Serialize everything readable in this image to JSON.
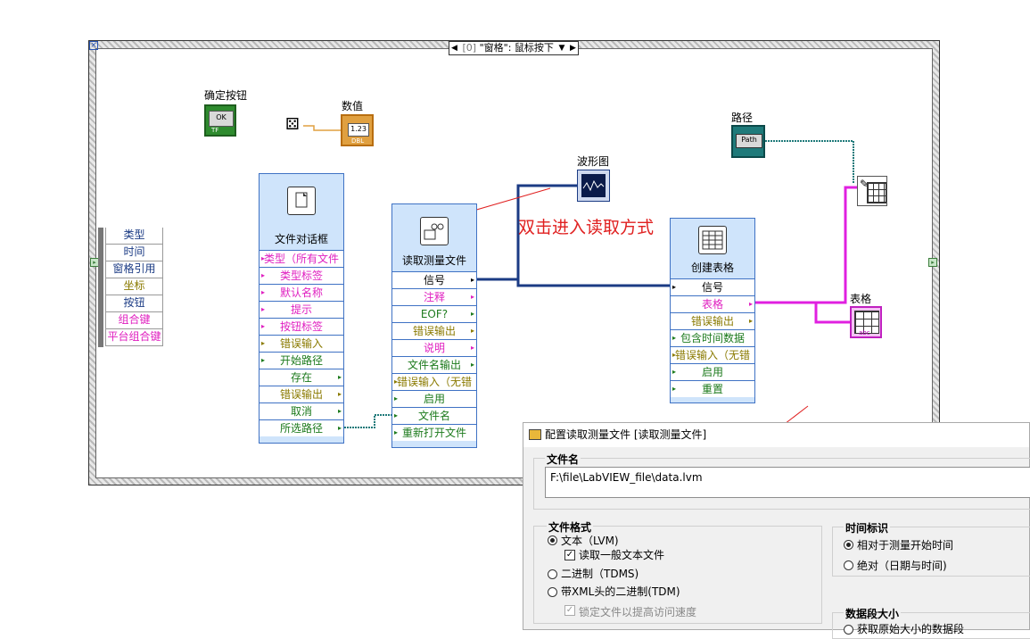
{
  "event_case": {
    "index": "[0]",
    "label": "\"窗格\": 鼠标按下"
  },
  "event_data": {
    "items": [
      "类型",
      "时间",
      "窗格引用",
      "坐标",
      "按钮",
      "组合键",
      "平台组合键"
    ]
  },
  "terminals": {
    "ok_button": {
      "label": "确定按钮",
      "face": "OK",
      "type_badge": "TF"
    },
    "numeric": {
      "label": "数值",
      "face": "1.23",
      "type_badge": "DBL"
    },
    "path": {
      "label": "路径",
      "face": "Path"
    },
    "waveform_graph": {
      "label": "波形图"
    },
    "table": {
      "label": "表格",
      "badge": "abc"
    }
  },
  "file_dialog": {
    "title": "文件对话框",
    "items": [
      "类型（所有文件",
      "类型标签",
      "默认名称",
      "提示",
      "按钮标签",
      "错误输入",
      "开始路径",
      "存在",
      "错误输出",
      "取消",
      "所选路径"
    ]
  },
  "read_file": {
    "title": "读取测量文件",
    "items": [
      "信号",
      "注释",
      "EOF?",
      "错误输出",
      "说明",
      "文件名输出",
      "错误输入（无错",
      "启用",
      "文件名",
      "重新打开文件"
    ]
  },
  "build_table": {
    "title": "创建表格",
    "items": [
      "信号",
      "表格",
      "错误输出",
      "包含时间数据",
      "错误输入（无错",
      "启用",
      "重置"
    ]
  },
  "annotation": "双击进入读取方式",
  "dialog": {
    "title": "配置读取测量文件 [读取测量文件]",
    "filename_group": "文件名",
    "filename_value": "F:\\file\\LabVIEW_file\\data.lvm",
    "format_group": "文件格式",
    "format_options": [
      "文本（LVM)",
      "二进制（TDMS)",
      "带XML头的二进制(TDM)"
    ],
    "read_generic_text": "读取一般文本文件",
    "lock_file": "锁定文件以提高访问速度",
    "timestamp_group": "时间标识",
    "timestamp_options": [
      "相对于测量开始时间",
      "绝对（日期与时间)"
    ],
    "segment_group": "数据段大小",
    "segment_option": "获取原始大小的数据段"
  },
  "colors": {
    "annotation": "#e02020",
    "pink_label": "#e020c0",
    "olive_label": "#8a7a00",
    "green_label": "#1c7a1c",
    "dynamic_wire": "#1b3b84",
    "path_wire": "#1f7a7a",
    "table_wire": "#e020e0",
    "express_vi_bg": "#cfe4fb"
  }
}
